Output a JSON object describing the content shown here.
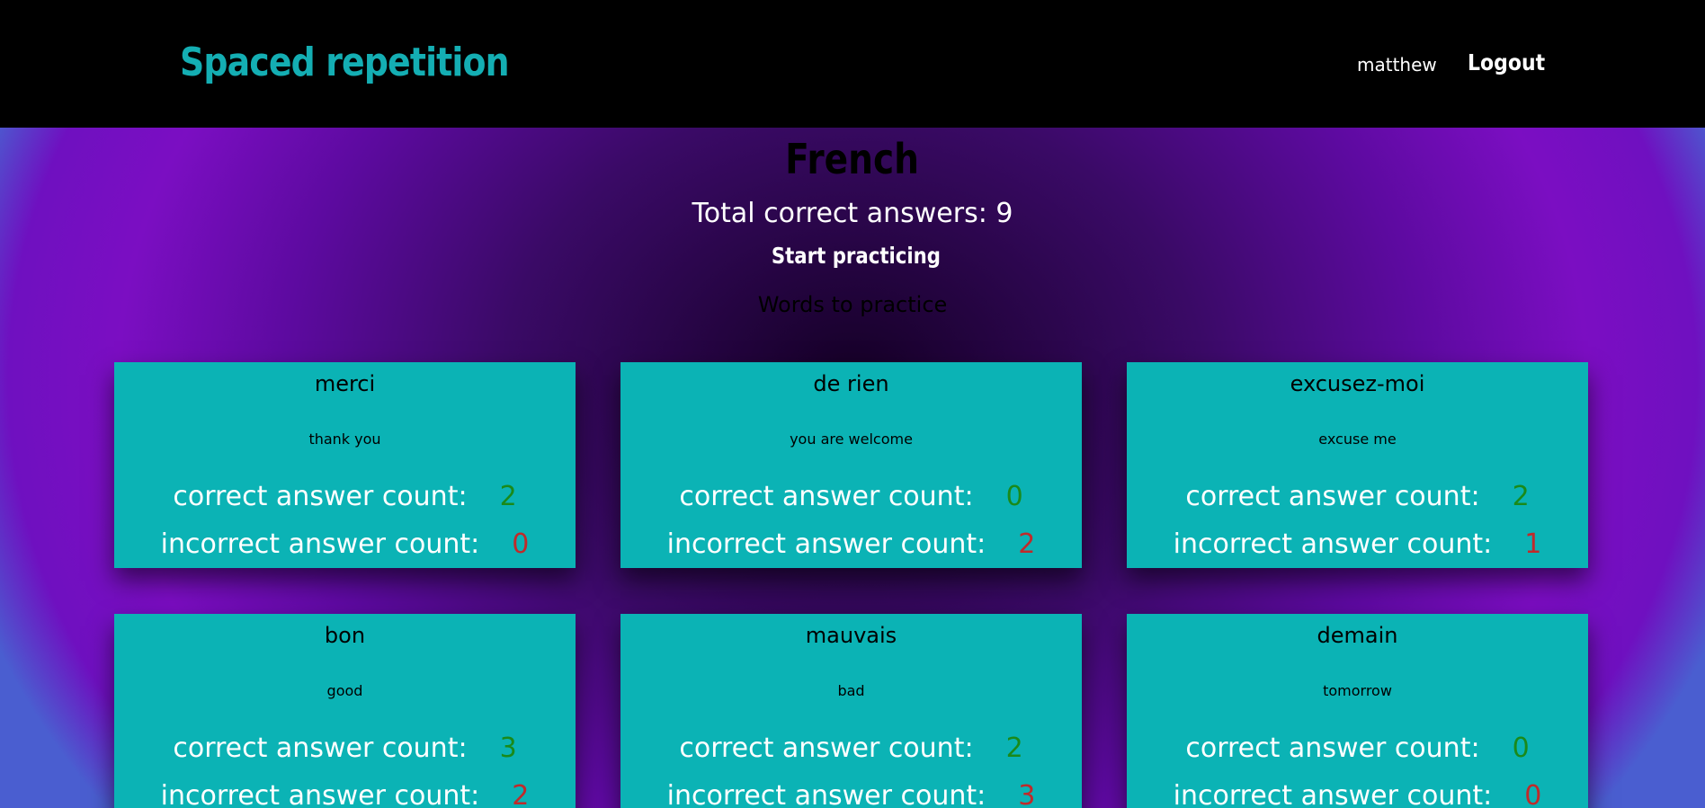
{
  "header": {
    "brand": "Spaced repetition",
    "username": "matthew",
    "logout_label": "Logout"
  },
  "main": {
    "language": "French",
    "total_correct": "Total correct answers: 9",
    "start_label": "Start practicing",
    "words_heading": "Words to practice"
  },
  "labels": {
    "correct": "correct answer count:",
    "incorrect": "incorrect answer count:"
  },
  "words": [
    {
      "word": "merci",
      "translation": "thank you",
      "correct": "2",
      "incorrect": "0"
    },
    {
      "word": "de rien",
      "translation": "you are welcome",
      "correct": "0",
      "incorrect": "2"
    },
    {
      "word": "excusez-moi",
      "translation": "excuse me",
      "correct": "2",
      "incorrect": "1"
    },
    {
      "word": "bon",
      "translation": "good",
      "correct": "3",
      "incorrect": "2"
    },
    {
      "word": "mauvais",
      "translation": "bad",
      "correct": "2",
      "incorrect": "3"
    },
    {
      "word": "demain",
      "translation": "tomorrow",
      "correct": "0",
      "incorrect": "0"
    }
  ],
  "colors": {
    "brand": "#14aeb3",
    "card_bg": "#0bb3b5",
    "correct": "#1a8a1a",
    "incorrect": "#c02a2a"
  }
}
